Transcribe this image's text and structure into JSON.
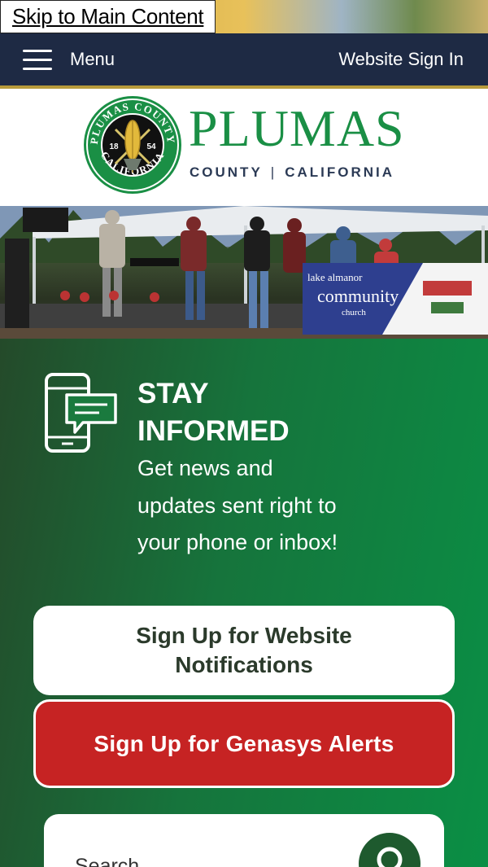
{
  "skip_link": "Skip to Main Content",
  "nav": {
    "menu_label": "Menu",
    "signin_label": "Website Sign In"
  },
  "brand": {
    "name": "PLUMAS",
    "sub_left": "COUNTY",
    "sub_sep": "|",
    "sub_right": "CALIFORNIA",
    "seal_top": "PLUMAS COUNTY",
    "seal_bottom": "CALIFORNIA",
    "seal_year_left": "18",
    "seal_year_right": "54"
  },
  "photo": {
    "banner_text_1": "lake almanor",
    "banner_text_2": "community",
    "banner_text_3": "church"
  },
  "stay_informed": {
    "title": "STAY INFORMED",
    "description": "Get news and updates sent right to your phone or inbox!",
    "notify_button": "Sign Up for Website Notifications",
    "genasys_button": "Sign Up for Genasys Alerts"
  },
  "search": {
    "placeholder": "Search"
  },
  "colors": {
    "nav_bg": "#1e2a44",
    "brand_green": "#1a8f45",
    "alert_red": "#c62323",
    "section_green": "#16743c"
  }
}
